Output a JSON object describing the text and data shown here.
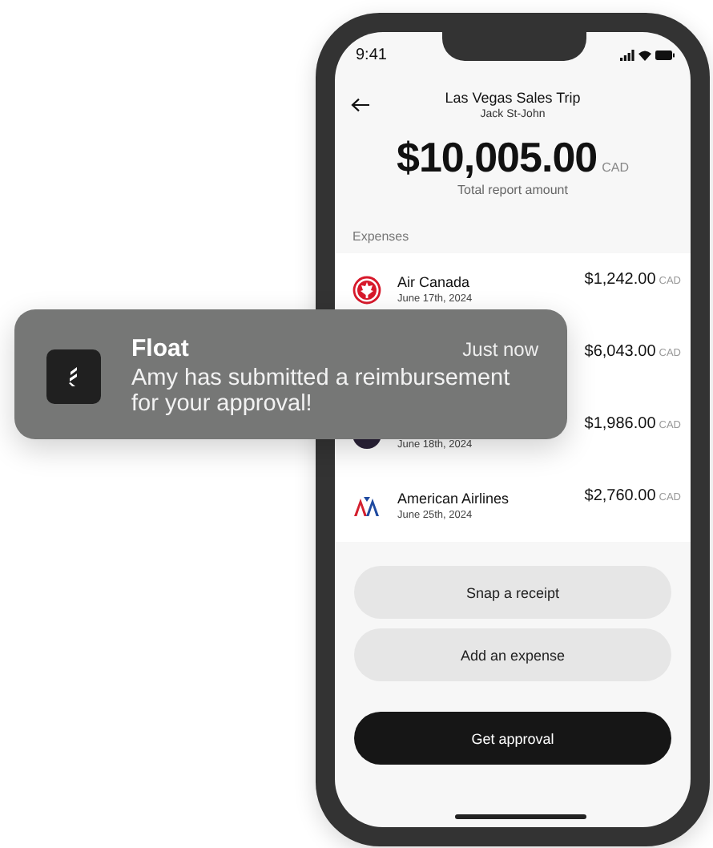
{
  "status_bar": {
    "time": "9:41"
  },
  "header": {
    "title": "Las Vegas Sales Trip",
    "subtitle": "Jack St-John"
  },
  "total": {
    "amount": "$10,005.00",
    "currency": "CAD",
    "caption": "Total report amount"
  },
  "expenses": {
    "heading": "Expenses",
    "rows": [
      {
        "kind": "maple",
        "name": "Air Canada",
        "date": "June 17th, 2024",
        "amount": "$1,242.00",
        "currency": "CAD"
      },
      {
        "amount": "$6,043.00",
        "currency": "CAD"
      },
      {
        "kind": "round",
        "date": "June 18th, 2024",
        "amount": "$1,986.00",
        "currency": "CAD"
      },
      {
        "kind": "aa",
        "name": "American Airlines",
        "date": "June 25th, 2024",
        "amount": "$2,760.00",
        "currency": "CAD"
      }
    ]
  },
  "buttons": [
    {
      "label": "Snap a receipt",
      "kind": "secondary"
    },
    {
      "label": "Add an expense",
      "kind": "secondary"
    },
    {
      "label": "Get approval",
      "kind": "primary"
    }
  ],
  "notification": {
    "app": "Float",
    "time": "Just now",
    "message": "Amy has submitted a reimbursement for your approval!"
  }
}
